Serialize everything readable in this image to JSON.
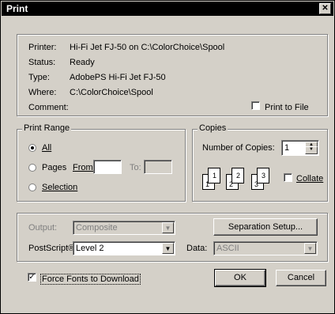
{
  "window": {
    "title": "Print"
  },
  "printer_info": {
    "printer_label": "Printer:",
    "printer_value": "Hi-Fi Jet FJ-50 on C:\\ColorChoice\\Spool",
    "status_label": "Status:",
    "status_value": "Ready",
    "type_label": "Type:",
    "type_value": "AdobePS Hi-Fi Jet FJ-50",
    "where_label": "Where:",
    "where_value": "C:\\ColorChoice\\Spool",
    "comment_label": "Comment:",
    "print_to_file_label": "Print to File",
    "print_to_file_checked": false
  },
  "print_range": {
    "group_label": "Print Range",
    "all_label": "All",
    "pages_label": "Pages",
    "from_label": "From:",
    "from_value": "",
    "to_label": "To:",
    "to_value": "",
    "selection_label": "Selection",
    "selected": "All"
  },
  "copies": {
    "group_label": "Copies",
    "number_label": "Number of Copies:",
    "number_value": "1",
    "collate_label": "Collate",
    "collate_checked": false,
    "page_icons": [
      "1",
      "1",
      "2",
      "2",
      "3",
      "3"
    ]
  },
  "options": {
    "output_label": "Output:",
    "output_value": "Composite",
    "postscript_label": "PostScript®:",
    "postscript_value": "Level 2",
    "data_label": "Data:",
    "data_value": "ASCII",
    "separation_button": "Separation Setup..."
  },
  "footer": {
    "force_fonts_label": "Force Fonts to Download",
    "force_fonts_checked": true,
    "ok_button": "OK",
    "cancel_button": "Cancel"
  }
}
